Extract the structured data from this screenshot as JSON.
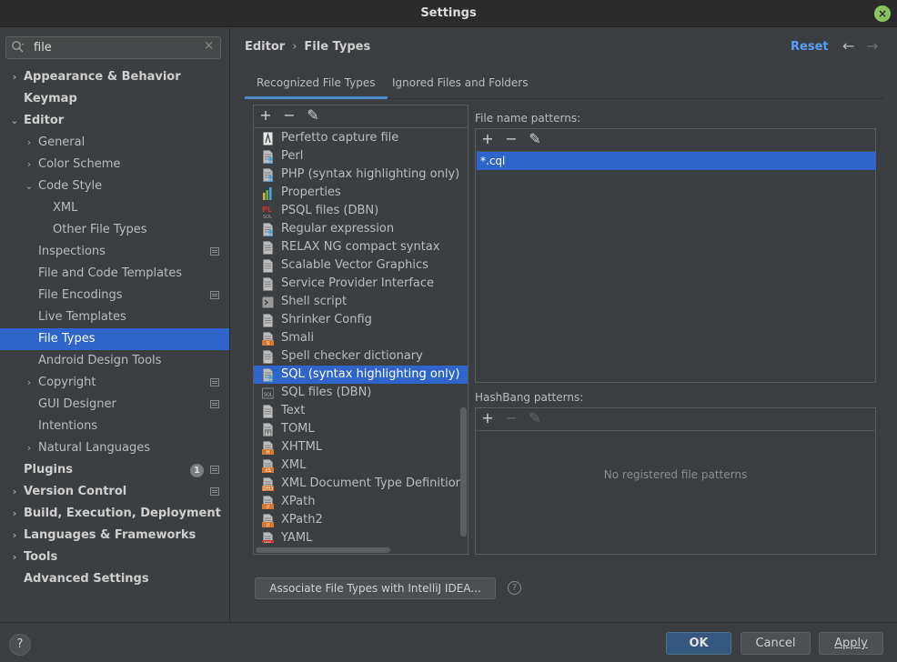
{
  "window": {
    "title": "Settings",
    "close_icon": "×"
  },
  "search": {
    "value": "file",
    "clear_icon": "×"
  },
  "sidebar": {
    "items": [
      {
        "label": "Appearance & Behavior",
        "level": 0,
        "chevron": "›",
        "bold": true
      },
      {
        "label": "Keymap",
        "level": 0,
        "chevron": "",
        "bold": true
      },
      {
        "label": "Editor",
        "level": 0,
        "chevron": "⌄",
        "bold": true
      },
      {
        "label": "General",
        "level": 1,
        "chevron": "›"
      },
      {
        "label": "Color Scheme",
        "level": 1,
        "chevron": "›"
      },
      {
        "label": "Code Style",
        "level": 1,
        "chevron": "⌄"
      },
      {
        "label": "XML",
        "level": 2,
        "chevron": ""
      },
      {
        "label": "Other File Types",
        "level": 2,
        "chevron": ""
      },
      {
        "label": "Inspections",
        "level": 1,
        "chevron": "",
        "mark": true
      },
      {
        "label": "File and Code Templates",
        "level": 1,
        "chevron": ""
      },
      {
        "label": "File Encodings",
        "level": 1,
        "chevron": "",
        "mark": true
      },
      {
        "label": "Live Templates",
        "level": 1,
        "chevron": ""
      },
      {
        "label": "File Types",
        "level": 1,
        "chevron": "",
        "selected": true
      },
      {
        "label": "Android Design Tools",
        "level": 1,
        "chevron": ""
      },
      {
        "label": "Copyright",
        "level": 1,
        "chevron": "›",
        "mark": true
      },
      {
        "label": "GUI Designer",
        "level": 1,
        "chevron": "",
        "mark": true
      },
      {
        "label": "Intentions",
        "level": 1,
        "chevron": ""
      },
      {
        "label": "Natural Languages",
        "level": 1,
        "chevron": "›"
      },
      {
        "label": "Plugins",
        "level": 0,
        "chevron": "",
        "bold": true,
        "mark": true,
        "badge": "1"
      },
      {
        "label": "Version Control",
        "level": 0,
        "chevron": "›",
        "bold": true,
        "mark": true
      },
      {
        "label": "Build, Execution, Deployment",
        "level": 0,
        "chevron": "›",
        "bold": true
      },
      {
        "label": "Languages & Frameworks",
        "level": 0,
        "chevron": "›",
        "bold": true
      },
      {
        "label": "Tools",
        "level": 0,
        "chevron": "›",
        "bold": true
      },
      {
        "label": "Advanced Settings",
        "level": 0,
        "chevron": "",
        "bold": true
      }
    ]
  },
  "header": {
    "breadcrumb_parent": "Editor",
    "breadcrumb_sep": "›",
    "breadcrumb_current": "File Types",
    "reset_label": "Reset",
    "back_icon": "←",
    "forward_icon": "→"
  },
  "tabs": [
    {
      "label": "Recognized File Types",
      "active": true
    },
    {
      "label": "Ignored Files and Folders",
      "active": false
    }
  ],
  "toolbar_icons": {
    "add": "+",
    "remove": "−",
    "edit": "✎"
  },
  "file_types": [
    {
      "label": "Perfetto capture file",
      "icon": "perfetto",
      "color": "#d6d6d6"
    },
    {
      "label": "Perl",
      "icon": "perl",
      "color": "#4aa3df"
    },
    {
      "label": "PHP (syntax highlighting only)",
      "icon": "php",
      "color": "#4aa3df"
    },
    {
      "label": "Properties",
      "icon": "properties",
      "color": "#e3b341"
    },
    {
      "label": "PSQL files (DBN)",
      "icon": "psql",
      "color": "#cc3333"
    },
    {
      "label": "Regular expression",
      "icon": "regex",
      "color": "#4aa3df"
    },
    {
      "label": "RELAX NG compact syntax",
      "icon": "doc",
      "color": "#9a9a9a"
    },
    {
      "label": "Scalable Vector Graphics",
      "icon": "doc",
      "color": "#9a9a9a"
    },
    {
      "label": "Service Provider Interface",
      "icon": "doc",
      "color": "#9a9a9a"
    },
    {
      "label": "Shell script",
      "icon": "shell",
      "color": "#9a9a9a"
    },
    {
      "label": "Shrinker Config",
      "icon": "doc",
      "color": "#9a9a9a"
    },
    {
      "label": "Smali",
      "icon": "smali",
      "color": "#d9762f"
    },
    {
      "label": "Spell checker dictionary",
      "icon": "spell",
      "color": "#9a9a9a"
    },
    {
      "label": "SQL (syntax highlighting only)",
      "icon": "sql",
      "color": "#4aa3df",
      "selected": true
    },
    {
      "label": "SQL files (DBN)",
      "icon": "sqldbn",
      "color": "#9a9a9a"
    },
    {
      "label": "Text",
      "icon": "doc",
      "color": "#9a9a9a"
    },
    {
      "label": "TOML",
      "icon": "toml",
      "color": "#9a9a9a"
    },
    {
      "label": "XHTML",
      "icon": "xhtml",
      "color": "#d9762f"
    },
    {
      "label": "XML",
      "icon": "xml",
      "color": "#d9762f"
    },
    {
      "label": "XML Document Type Definition",
      "icon": "dtd",
      "color": "#d9762f"
    },
    {
      "label": "XPath",
      "icon": "xpath",
      "color": "#d9762f"
    },
    {
      "label": "XPath2",
      "icon": "xpath",
      "color": "#d9762f"
    },
    {
      "label": "YAML",
      "icon": "yaml",
      "color": "#cc3333"
    }
  ],
  "file_name_patterns": {
    "label": "File name patterns:",
    "items": [
      "*.cql"
    ]
  },
  "hashbang_patterns": {
    "label": "HashBang patterns:",
    "empty_text": "No registered file patterns"
  },
  "associate_button": "Associate File Types with IntelliJ IDEA...",
  "help_icon": "?",
  "footer": {
    "ok": "OK",
    "cancel": "Cancel",
    "apply": "Apply"
  },
  "colors": {
    "accent": "#2f65ca",
    "link": "#589df6",
    "background": "#3c3f41"
  }
}
